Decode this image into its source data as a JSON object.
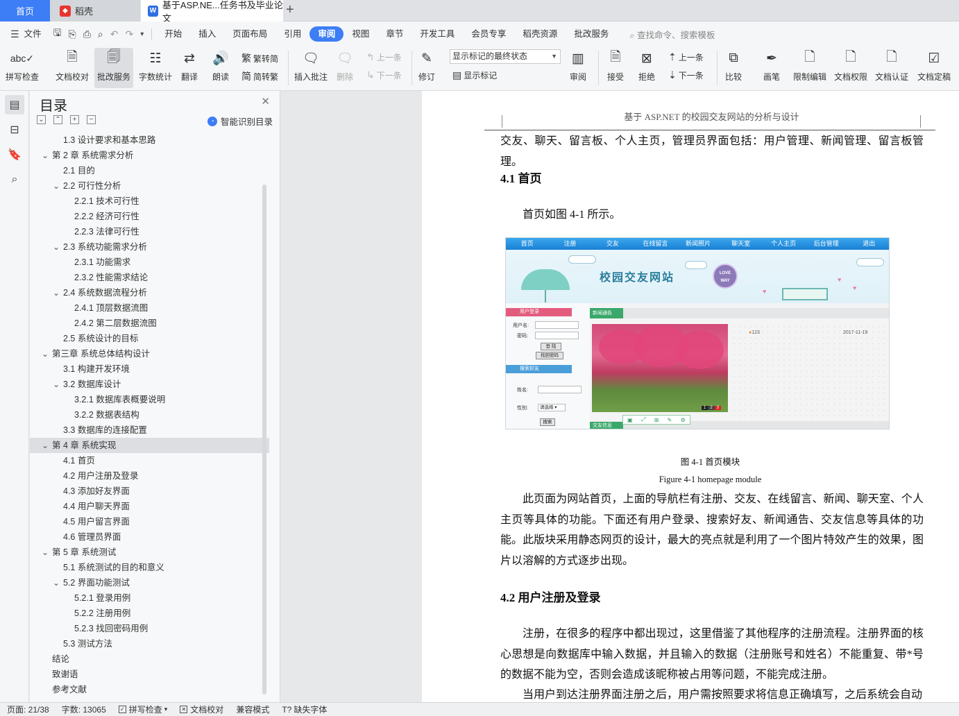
{
  "tabs": {
    "home": "首页",
    "daoke": "稻壳",
    "doc": "基于ASP.NE...任务书及毕业论文",
    "add": "+"
  },
  "menu": {
    "file": "文件",
    "items": [
      "开始",
      "插入",
      "页面布局",
      "引用",
      "审阅",
      "视图",
      "章节",
      "开发工具",
      "会员专享",
      "稻壳资源",
      "批改服务"
    ],
    "active": "审阅",
    "search": "查找命令、搜索模板"
  },
  "ribbon": {
    "spellcheck": "拼写检查",
    "proofread": "文档校对",
    "review_service": "批改服务",
    "wordcount": "字数统计",
    "translate": "翻译",
    "read_aloud": "朗读",
    "trad_to_simp": "繁转简",
    "simp_to_trad": "简转繁",
    "insert_comment": "插入批注",
    "delete": "删除",
    "prev": "上一条",
    "next": "下一条",
    "track_changes": "修订",
    "markup_state": "显示标记的最终状态",
    "show_markup": "显示标记",
    "review": "审阅",
    "accept": "接受",
    "reject": "拒绝",
    "prev2": "上一条",
    "next2": "下一条",
    "compare": "比较",
    "ink": "画笔",
    "restrict_edit": "限制编辑",
    "doc_rights": "文档权限",
    "doc_cert": "文档认证",
    "doc_finalize": "文档定稿"
  },
  "toc": {
    "title": "目录",
    "smart": "智能识别目录",
    "items": [
      {
        "level": 2,
        "text": "1.3 设计要求和基本思路",
        "arrow": false
      },
      {
        "level": 1,
        "text": "第 2 章  系统需求分析",
        "arrow": true
      },
      {
        "level": 2,
        "text": "2.1 目的",
        "arrow": false
      },
      {
        "level": 2,
        "text": "2.2 可行性分析",
        "arrow": true
      },
      {
        "level": 3,
        "text": "2.2.1 技术可行性",
        "arrow": false
      },
      {
        "level": 3,
        "text": "2.2.2 经济可行性",
        "arrow": false
      },
      {
        "level": 3,
        "text": "2.2.3 法律可行性",
        "arrow": false
      },
      {
        "level": 2,
        "text": "2.3 系统功能需求分析",
        "arrow": true
      },
      {
        "level": 3,
        "text": "2.3.1 功能需求",
        "arrow": false
      },
      {
        "level": 3,
        "text": "2.3.2 性能需求结论",
        "arrow": false
      },
      {
        "level": 2,
        "text": "2.4 系统数据流程分析",
        "arrow": true
      },
      {
        "level": 3,
        "text": "2.4.1 顶层数据流图",
        "arrow": false
      },
      {
        "level": 3,
        "text": "2.4.2 第二层数据流图",
        "arrow": false
      },
      {
        "level": 2,
        "text": "2.5 系统设计的目标",
        "arrow": false
      },
      {
        "level": 1,
        "text": "第三章  系统总体结构设计",
        "arrow": true
      },
      {
        "level": 2,
        "text": "3.1 构建开发环境",
        "arrow": false
      },
      {
        "level": 2,
        "text": "3.2 数据库设计",
        "arrow": true
      },
      {
        "level": 3,
        "text": "3.2.1 数据库表概要说明",
        "arrow": false
      },
      {
        "level": 3,
        "text": "3.2.2 数据表结构",
        "arrow": false
      },
      {
        "level": 2,
        "text": "3.3 数据库的连接配置",
        "arrow": false
      },
      {
        "level": 1,
        "text": "第 4 章  系统实现",
        "arrow": true,
        "selected": true
      },
      {
        "level": 2,
        "text": "4.1 首页",
        "arrow": false
      },
      {
        "level": 2,
        "text": "4.2 用户注册及登录",
        "arrow": false
      },
      {
        "level": 2,
        "text": "4.3 添加好友界面",
        "arrow": false
      },
      {
        "level": 2,
        "text": "4.4 用户聊天界面",
        "arrow": false
      },
      {
        "level": 2,
        "text": "4.5 用户留言界面",
        "arrow": false
      },
      {
        "level": 2,
        "text": "4.6 管理员界面",
        "arrow": false
      },
      {
        "level": 1,
        "text": "第 5 章  系统测试",
        "arrow": true
      },
      {
        "level": 2,
        "text": "5.1 系统测试的目的和意义",
        "arrow": false
      },
      {
        "level": 2,
        "text": "5.2 界面功能测试",
        "arrow": true
      },
      {
        "level": 3,
        "text": "5.2.1 登录用例",
        "arrow": false
      },
      {
        "level": 3,
        "text": "5.2.2 注册用例",
        "arrow": false
      },
      {
        "level": 3,
        "text": "5.2.3 找回密码用例",
        "arrow": false
      },
      {
        "level": 2,
        "text": "5.3 测试方法",
        "arrow": false
      },
      {
        "level": 1,
        "text": "结论",
        "arrow": false
      },
      {
        "level": 1,
        "text": "致谢语",
        "arrow": false
      },
      {
        "level": 1,
        "text": "参考文献",
        "arrow": false
      }
    ]
  },
  "doc": {
    "header": "基于 ASP.NET 的校园交友网站的分析与设计",
    "p0": "交友、聊天、留言板、个人主页，管理员界面包括：用户管理、新闻管理、留言板管理。",
    "h41": "4.1 首页",
    "p1": "首页如图 4-1 所示。",
    "cap_cn": "图 4-1 首页模块",
    "cap_en": "Figure 4-1 homepage module",
    "p2": "此页面为网站首页，上面的导航栏有注册、交友、在线留言、新闻、聊天室、个人主页等具体的功能。下面还有用户登录、搜索好友、新闻通告、交友信息等具体的功能。此版块采用静态网页的设计，最大的亮点就是利用了一个图片特效产生的效果，图片以溶解的方式逐步出现。",
    "h42": "4.2 用户注册及登录",
    "p3": "注册，在很多的程序中都出现过，这里借鉴了其他程序的注册流程。注册界面的核心思想是向数据库中输入数据，并且输入的数据（注册账号和姓名）不能重复、带*号的数据不能为空，否则会造成该昵称被占用等问题，不能完成注册。",
    "p4": "当用户到达注册界面注册之后，用户需按照要求将信息正确填写，之后系统会自动"
  },
  "figure": {
    "nav": [
      "首页",
      "注册",
      "交友",
      "在线留言",
      "新闻照片",
      "聊天室",
      "个人主页",
      "后台管理",
      "退出"
    ],
    "banner_title": "校园交友网站",
    "love": "LOVE",
    "way": "WAY",
    "login_title": "用户登录",
    "username": "用户名:",
    "password": "密码:",
    "login_btn": "登 陆",
    "forgot_btn": "找回密码",
    "search_title": "搜索好友",
    "name": "姓名:",
    "gender": "性别:",
    "gender_select": "请选择",
    "search_btn": "搜索",
    "news_tab": "新闻通告",
    "news_item": "123",
    "news_date": "2017-11-19",
    "friend_tab": "交友信息",
    "pager": [
      "1",
      "2",
      "3"
    ]
  },
  "status": {
    "page": "页面: 21/38",
    "words": "字数: 13065",
    "spell": "拼写检查",
    "proof": "文档校对",
    "compat": "兼容模式",
    "missing_font": "缺失字体"
  }
}
